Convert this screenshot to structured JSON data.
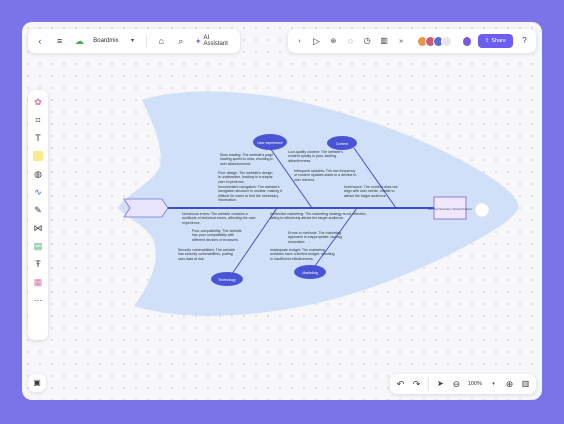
{
  "app": {
    "brand": "Boardmix",
    "ai_label": "AI Assistant"
  },
  "toolbar": {
    "share_label": "Share",
    "zoom_level": "100%"
  },
  "diagram": {
    "head_text": "Low User Retention / Product Problem",
    "categories": [
      {
        "id": "user",
        "label": "User experience"
      },
      {
        "id": "content",
        "label": "Content"
      },
      {
        "id": "technology",
        "label": "Technology"
      },
      {
        "id": "marketing",
        "label": "Marketing"
      }
    ],
    "notes": {
      "user_1": "Slow loading: The website's page loading speed is slow, resulting in user abandonment.",
      "user_2": "Poor design: The website's design is unattractive, leading to a subpar user experience.",
      "user_3": "Inconvenient navigation: The website's navigation structure is unclear, making it difficult for users to find the necessary information.",
      "content_1": "Low-quality content: The website's content quality is poor, lacking attractiveness.",
      "content_2": "Infrequent updates: The low frequency of content updates leads to a decline in user interest.",
      "content_3": "Irrelevance: The content does not align with user needs, unable to attract the target audience.",
      "tech_1": "Numerous errors: The website contains a multitude of technical errors, affecting the user experience.",
      "tech_2": "Poor compatibility: The website has poor compatibility with different devices or browsers.",
      "tech_3": "Security vulnerabilities: The website has security vulnerabilities, putting user data at risk.",
      "mkt_1": "Ineffective marketing: The marketing strategy is not effective, failing to effectively attract the target audience.",
      "mkt_2": "Errors in methods: The marketing approach is inappropriate, lacking innovation.",
      "mkt_3": "Inadequate budget: The marketing activities have a limited budget, resulting in insufficient effectiveness."
    }
  },
  "colors": {
    "accent": "#6d5df0",
    "fish": "#cfe0f8",
    "spine": "#2b39c9",
    "bubble": "#4a55d6"
  },
  "icons": [
    "back-icon",
    "menu-icon",
    "cloud-icon",
    "tag-icon",
    "search-icon",
    "ai-icon",
    "play-icon",
    "comment-icon",
    "timer-icon",
    "chart-icon",
    "more-icon",
    "help-icon"
  ]
}
